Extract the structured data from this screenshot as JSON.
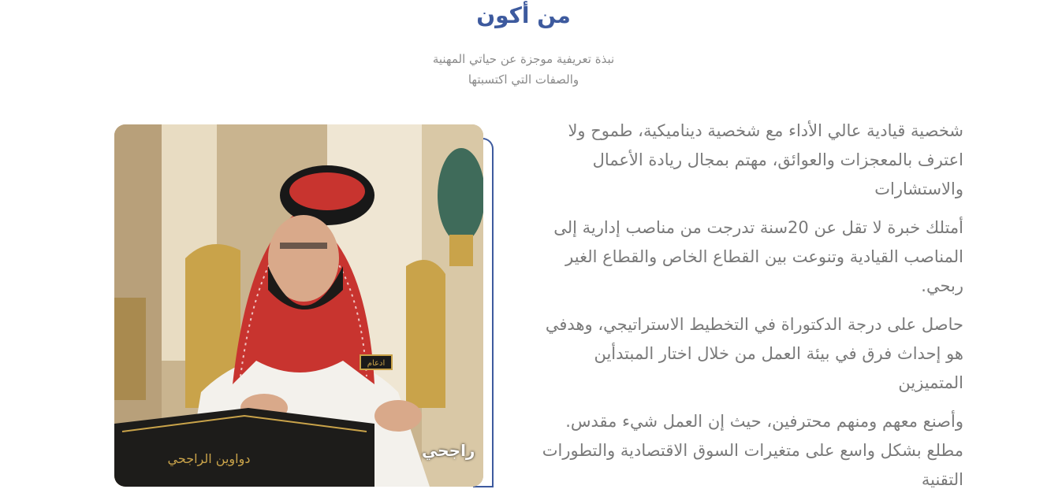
{
  "section": {
    "title": "من أكون",
    "subtitle_line1": "نبذة تعريفية موجزة عن حياتي المهنية",
    "subtitle_line2": "والصفات التي اكتسبتها"
  },
  "bio": {
    "paragraphs": [
      "شخصية قيادية عالي الأداء مع شخصية ديناميكية، طموح ولا اعترف بالمعجزات والعوائق، مهتم بمجال ريادة الأعمال والاستشارات",
      "أمتلك خبرة لا تقل عن 20سنة تدرجت من مناصب إدارية إلى المناصب القيادية وتنوعت بين القطاع الخاص والقطاع الغير ربحي.",
      "حاصل على درجة الدكتوراة في التخطيط الاستراتيجي، وهدفي هو إحداث فرق في بيئة العمل من خلال اختار المبتدأين المتميزين",
      "وأصنع معهم ومنهم محترفين، حيث إن العمل شيء مقدس. مطلع بشكل واسع على متغيرات السوق الاقتصادية والتطورات التقنية"
    ]
  },
  "photo": {
    "signature_text": "راجحي",
    "book_title": "دواوين الراجحي",
    "badge_text": "ادعام"
  },
  "colors": {
    "accent": "#3d5a9e",
    "text_gray": "#7a7a7a"
  }
}
